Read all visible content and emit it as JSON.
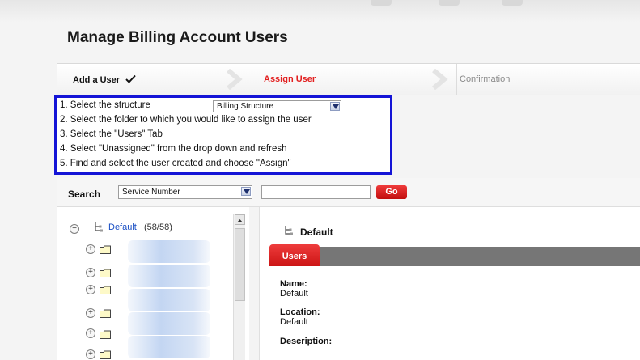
{
  "page": {
    "title": "Manage Billing Account Users"
  },
  "steps": [
    {
      "label": "Add a User",
      "state": "done"
    },
    {
      "label": "Assign User",
      "state": "active"
    },
    {
      "label": "Confirmation",
      "state": "pending"
    }
  ],
  "instructions": {
    "structure_select_value": "Billing Structure",
    "lines": [
      "1. Select the structure",
      "2. Select the folder to which you would like to assign the user",
      "3. Select the \"Users\" Tab",
      "4. Select \"Unassigned\" from the drop down and refresh",
      "5. Find and select the user created and choose \"Assign\""
    ]
  },
  "search": {
    "label": "Search",
    "type_value": "Service Number",
    "query_value": "",
    "go_label": "Go"
  },
  "tree": {
    "root": {
      "label": "Default",
      "count": "(58/58)",
      "toggle": "−"
    },
    "child_toggle": "+"
  },
  "detail": {
    "title": "Default",
    "tab_label": "Users",
    "fields": [
      {
        "label": "Name:",
        "value": "Default"
      },
      {
        "label": "Location:",
        "value": "Default"
      },
      {
        "label": "Description:",
        "value": ""
      }
    ]
  },
  "colors": {
    "accent_red": "#d41616",
    "highlight_box": "#1414d6",
    "link_blue": "#1a4fc4"
  }
}
